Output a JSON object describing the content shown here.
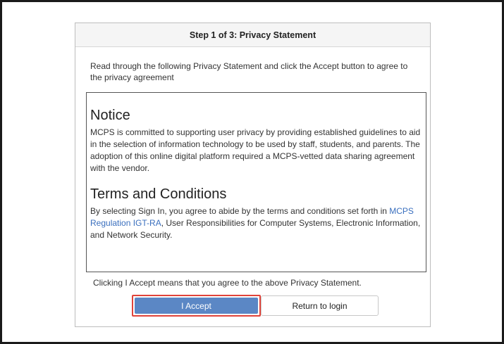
{
  "header": {
    "title": "Step 1 of 3: Privacy Statement"
  },
  "intro": {
    "text": "Read through the following Privacy Statement and click the Accept button to agree to the privacy agreement"
  },
  "statement": {
    "notice_title": "Notice",
    "notice_text": "MCPS is committed to supporting user privacy by providing established guidelines to aid in the selection of information technology to be used by staff, students, and parents. The adoption of this online digital platform required a MCPS-vetted data sharing agreement with the vendor.",
    "terms_title": "Terms and Conditions",
    "terms_text_before": "By selecting Sign In, you agree to abide by the terms and conditions set forth in ",
    "terms_link": "MCPS Regulation IGT-RA",
    "terms_text_after": ", User Responsibilities for Computer Systems, Electronic Information, and Network Security."
  },
  "footer": {
    "agree_note": "Clicking I Accept means that you agree to the above Privacy Statement.",
    "accept_label": "I Accept",
    "return_label": "Return to login"
  },
  "colors": {
    "accept_bg": "#5b87c5",
    "highlight_border": "#e0433a",
    "link": "#3a6fbe"
  }
}
